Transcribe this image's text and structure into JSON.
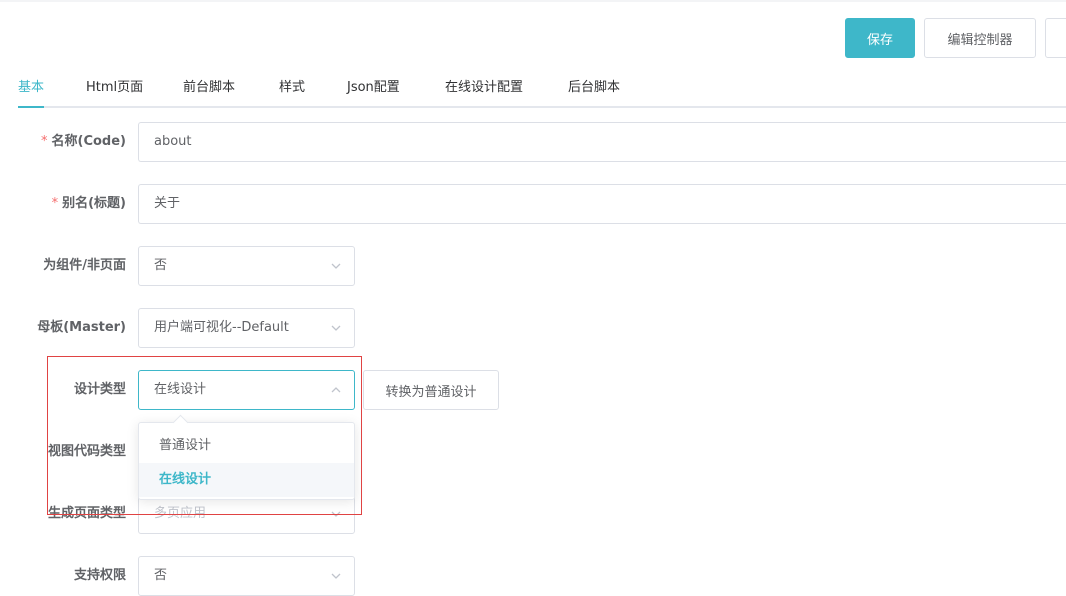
{
  "toolbar": {
    "save_label": "保存",
    "edit_controller_label": "编辑控制器"
  },
  "tabs": [
    {
      "label": "基本",
      "active": true
    },
    {
      "label": "Html页面"
    },
    {
      "label": "前台脚本"
    },
    {
      "label": "样式"
    },
    {
      "label": "Json配置"
    },
    {
      "label": "在线设计配置"
    },
    {
      "label": "后台脚本"
    }
  ],
  "form": {
    "name": {
      "label": "名称(Code)",
      "required": "*",
      "value": "about"
    },
    "alias": {
      "label": "别名(标题)",
      "required": "*",
      "value": "关于"
    },
    "is_component": {
      "label": "为组件/非页面",
      "value": "否"
    },
    "master": {
      "label": "母板(Master)",
      "value": "用户端可视化--Default"
    },
    "design_type": {
      "label": "设计类型",
      "value": "在线设计",
      "convert_button": "转换为普通设计"
    },
    "view_code_type": {
      "label": "视图代码类型"
    },
    "page_type": {
      "label": "生成页面类型",
      "value": "多页应用"
    },
    "support_permission": {
      "label": "支持权限",
      "value": "否"
    }
  },
  "dropdown": {
    "options": [
      {
        "label": "普通设计"
      },
      {
        "label": "在线设计",
        "selected": true
      }
    ]
  },
  "colors": {
    "accent": "#3eb7c9",
    "required": "#f56c6c",
    "highlight_box": "#e04343"
  }
}
